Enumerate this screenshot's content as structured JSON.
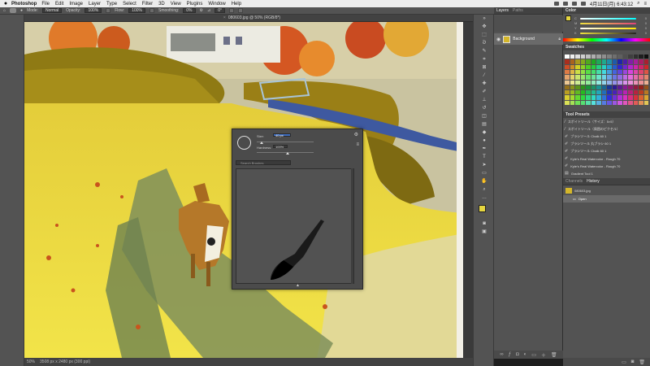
{
  "menubar": {
    "app_name": "Photoshop",
    "items": [
      "File",
      "Edit",
      "Image",
      "Layer",
      "Type",
      "Select",
      "Filter",
      "3D",
      "View",
      "Plugins",
      "Window",
      "Help"
    ],
    "clock": "4月11日(月) 6:43:12"
  },
  "options_bar": {
    "mode_label": "Mode:",
    "mode_value": "Normal",
    "opacity_label": "Opacity:",
    "opacity_value": "100%",
    "flow_label": "Flow:",
    "flow_value": "100%",
    "smoothing_label": "Smoothing:",
    "smoothing_value": "0%",
    "angle_value": "0°"
  },
  "document": {
    "tab_title": "080603.jpg @ 50% (RGB/8*)",
    "zoom": "50%",
    "doc_info": "3508 px x 2480 px (300 ppi)"
  },
  "layers_panel": {
    "tabs": [
      "Layers",
      "Paths"
    ],
    "layer_name": "Background"
  },
  "color_panel": {
    "title": "Color",
    "channels": [
      {
        "label": "C",
        "value": "0"
      },
      {
        "label": "M",
        "value": "0"
      },
      {
        "label": "Y",
        "value": "0"
      },
      {
        "label": "K",
        "value": "0"
      }
    ]
  },
  "swatches_panel": {
    "title": "Swatches"
  },
  "tool_presets_panel": {
    "title": "Tool Presets",
    "items": [
      "スポイトツール（サイズ：5×5）",
      "スポイトツール（周囲のピクセル）",
      "ブラシツール Chalk 60 1",
      "ブラシツール 丸ブラシ 60 1",
      "ブラシツール Chalk 60 1",
      "Kyle's Real Watercolor - Rough 70",
      "Kyle's Real Watercolor - Rough 70",
      "Gradient Tool 1"
    ],
    "current_only_label": "Current Tool Only"
  },
  "history_panel": {
    "tabs": [
      "Channels",
      "History"
    ],
    "snapshot_name": "080603.jpg",
    "state_name": "Open"
  },
  "brush_popup": {
    "size_label": "Size:",
    "size_value": "40 px",
    "hardness_label": "Hardness:",
    "hardness_value": "100%",
    "search_placeholder": "Search Brushes"
  },
  "colors": {
    "app_bg": "#535353",
    "panel_dark": "#424242",
    "highlight": "#3f6ec0",
    "foreground_swatch": "#e6d640",
    "background_swatch": "#ffffff"
  }
}
